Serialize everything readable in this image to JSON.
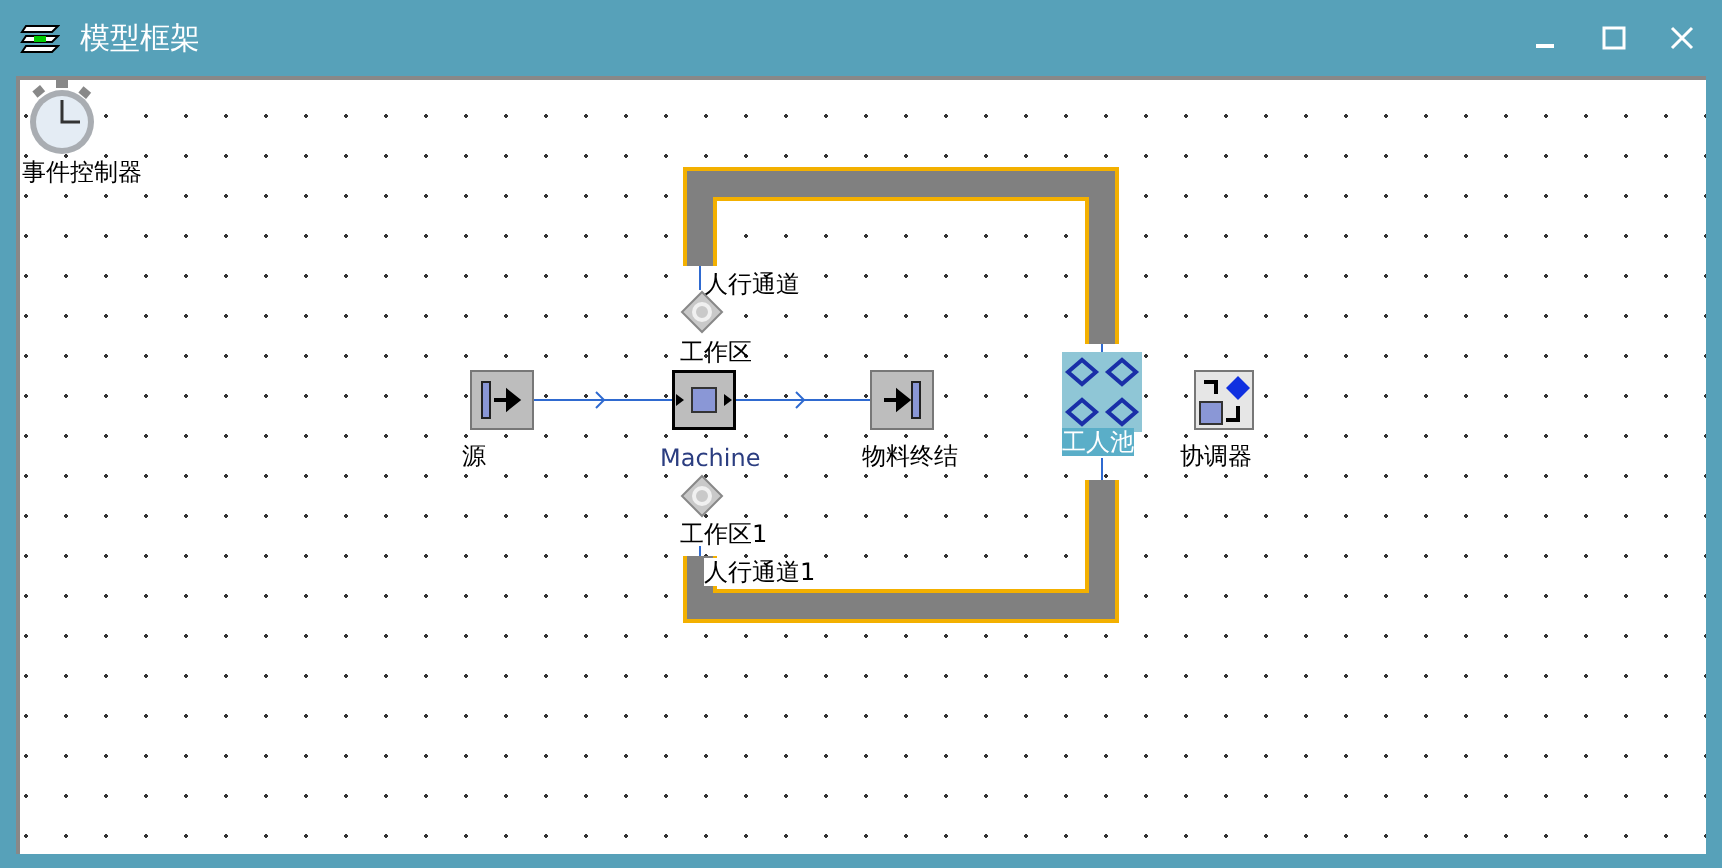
{
  "window": {
    "title": "模型框架"
  },
  "nodes": [
    {
      "kind": "timer",
      "label": "事件控制器",
      "selected": false
    },
    {
      "kind": "path",
      "label": "人行通道",
      "selected": false
    },
    {
      "kind": "workarea",
      "label": "工作区",
      "selected": false
    },
    {
      "kind": "source",
      "label": "源",
      "selected": false
    },
    {
      "kind": "machine",
      "label": "Machine",
      "selected": false
    },
    {
      "kind": "sink",
      "label": "物料终结",
      "selected": false
    },
    {
      "kind": "pool",
      "label": "工人池",
      "selected": true
    },
    {
      "kind": "coordinator",
      "label": "协调器",
      "selected": false
    },
    {
      "kind": "workarea",
      "label": "工作区1",
      "selected": false
    },
    {
      "kind": "path",
      "label": "人行通道1",
      "selected": false
    }
  ]
}
